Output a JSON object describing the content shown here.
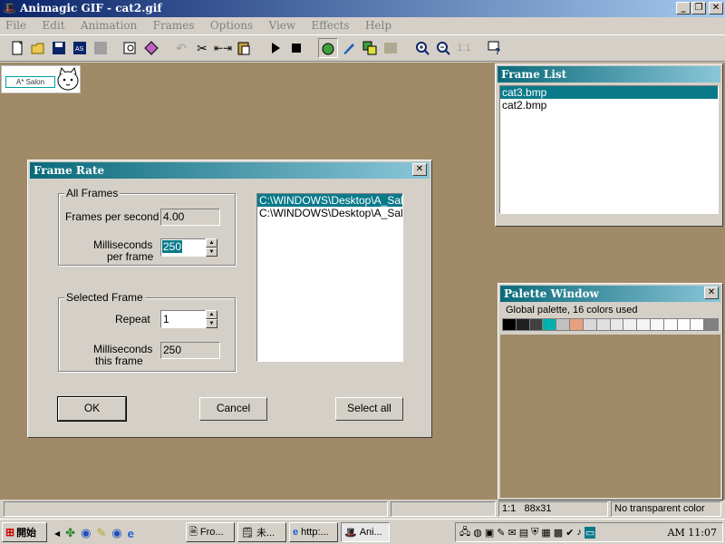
{
  "window": {
    "title": "Animagic GIF - cat2.gif"
  },
  "menu": [
    "File",
    "Edit",
    "Animation",
    "Frames",
    "Options",
    "View",
    "Effects",
    "Help"
  ],
  "toolbar_icons": [
    "new-icon",
    "open-icon",
    "save-icon",
    "save-as-icon",
    "save-gray-icon",
    "preview-icon",
    "optimize-icon",
    "undo-icon",
    "cut-icon",
    "resize-icon",
    "paste-icon",
    "play-icon",
    "stop-icon",
    "apple-icon",
    "brush-icon",
    "frames-icon",
    "palette-grid-icon",
    "zoom-in-icon",
    "zoom-out-icon",
    "actual-size-icon",
    "help-icon"
  ],
  "canvas": {
    "thumbnail_text": "A* Salon"
  },
  "frame_list": {
    "title": "Frame List",
    "items": [
      "cat3.bmp",
      "cat2.bmp"
    ],
    "selected_index": 0
  },
  "palette": {
    "title": "Palette Window",
    "info": "Global palette, 16 colors used",
    "colors": [
      "#000000",
      "#202020",
      "#404040",
      "#00b0b0",
      "#c0c0c0",
      "#e8a080",
      "#d8d8d8",
      "#e0e0e0",
      "#e8e8e8",
      "#f0f0f0",
      "#f4f4f4",
      "#f8f8f8",
      "#fcfcfc",
      "#ffffff",
      "#fdfdfd",
      "#808080"
    ]
  },
  "dialog": {
    "title": "Frame Rate",
    "all_frames": {
      "label": "All Frames",
      "fps_label": "Frames per second",
      "fps_value": "4.00",
      "ms_label_1": "Milliseconds",
      "ms_label_2": "per frame",
      "ms_value": "250"
    },
    "selected_frame": {
      "label": "Selected Frame",
      "repeat_label": "Repeat",
      "repeat_value": "1",
      "ms_label_1": "Milliseconds",
      "ms_label_2": "this frame",
      "ms_value": "250"
    },
    "files": [
      "C:\\WINDOWS\\Desktop\\A_Salo",
      "C:\\WINDOWS\\Desktop\\A_Salo"
    ],
    "ok": "OK",
    "cancel": "Cancel",
    "select_all": "Select all"
  },
  "status": {
    "zoom": "1:1",
    "size": "88x31",
    "transparency": "No transparent color"
  },
  "taskbar": {
    "start": "開始",
    "tasks": [
      "Fro...",
      "未...",
      "http:...",
      "Ani..."
    ],
    "clock": "AM 11:07"
  },
  "colors": {
    "workspace": "#a08a68",
    "selection": "#0a7a8a",
    "chrome": "#d4d0c8"
  }
}
